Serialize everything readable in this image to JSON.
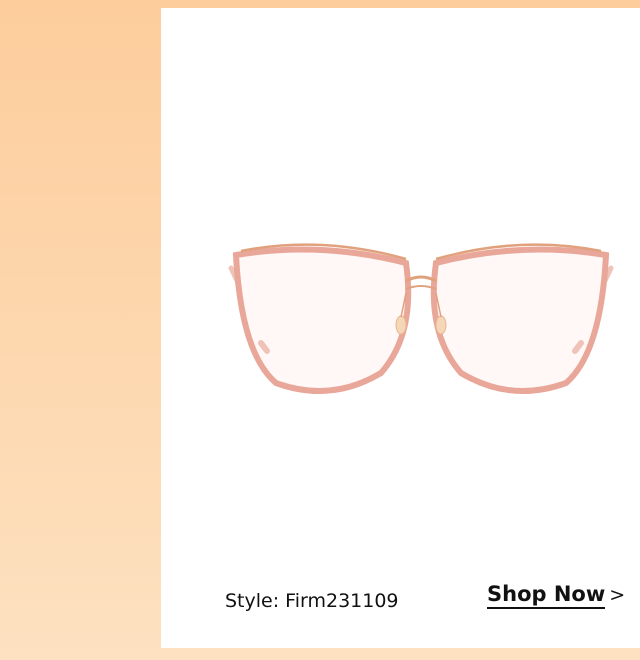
{
  "product": {
    "style_label": "Style: Firm231109",
    "image_icon": "eyeglasses-image"
  },
  "cta": {
    "label": "Shop Now",
    "chevron": ">",
    "icon": "chevron-right-icon"
  },
  "colors": {
    "background_top": "#fdcd9c",
    "background_bottom": "#fde1c0",
    "card": "#ffffff",
    "frame": "#e9a79a",
    "metal": "#e0a17c"
  }
}
